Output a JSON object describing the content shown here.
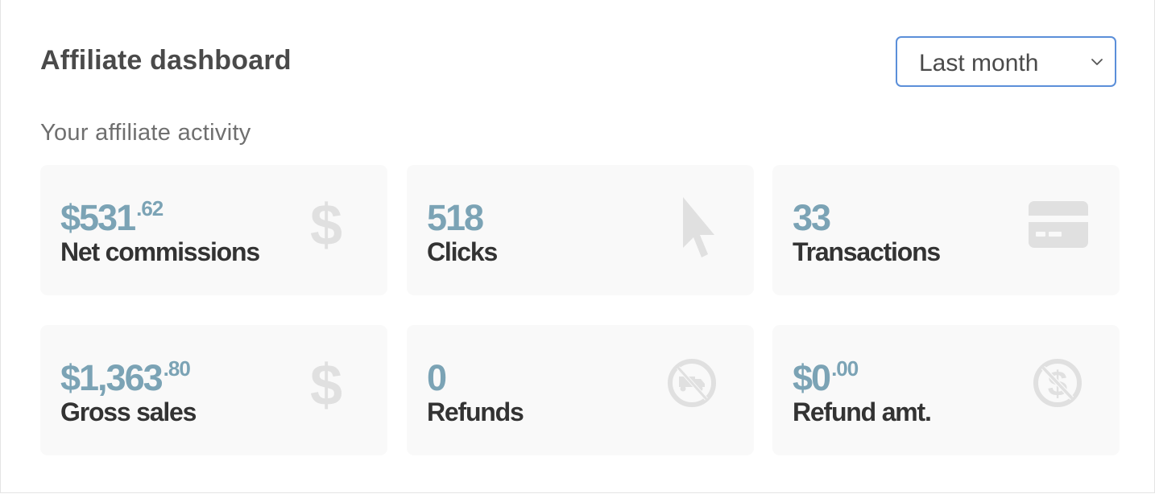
{
  "header": {
    "title": "Affiliate dashboard",
    "period_select": {
      "selected": "Last month"
    }
  },
  "subtitle": "Your affiliate activity",
  "stats": [
    {
      "id": "net-commissions",
      "value_main": "$531",
      "value_cents": ".62",
      "label": "Net commissions",
      "icon": "dollar-icon"
    },
    {
      "id": "clicks",
      "value_main": "518",
      "value_cents": "",
      "label": "Clicks",
      "icon": "cursor-icon"
    },
    {
      "id": "transactions",
      "value_main": "33",
      "value_cents": "",
      "label": "Transactions",
      "icon": "credit-card-icon"
    },
    {
      "id": "gross-sales",
      "value_main": "$1,363",
      "value_cents": ".80",
      "label": "Gross sales",
      "icon": "dollar-icon"
    },
    {
      "id": "refunds",
      "value_main": "0",
      "value_cents": "",
      "label": "Refunds",
      "icon": "no-shipping-icon"
    },
    {
      "id": "refund-amount",
      "value_main": "$0",
      "value_cents": ".00",
      "label": "Refund amt.",
      "icon": "no-dollar-icon"
    }
  ],
  "colors": {
    "accent_value": "#7ba3b5",
    "label_text": "#333333",
    "card_bg": "#f9f9f9",
    "icon_gray": "#e0e0e0",
    "select_border": "#5b8fd9"
  }
}
